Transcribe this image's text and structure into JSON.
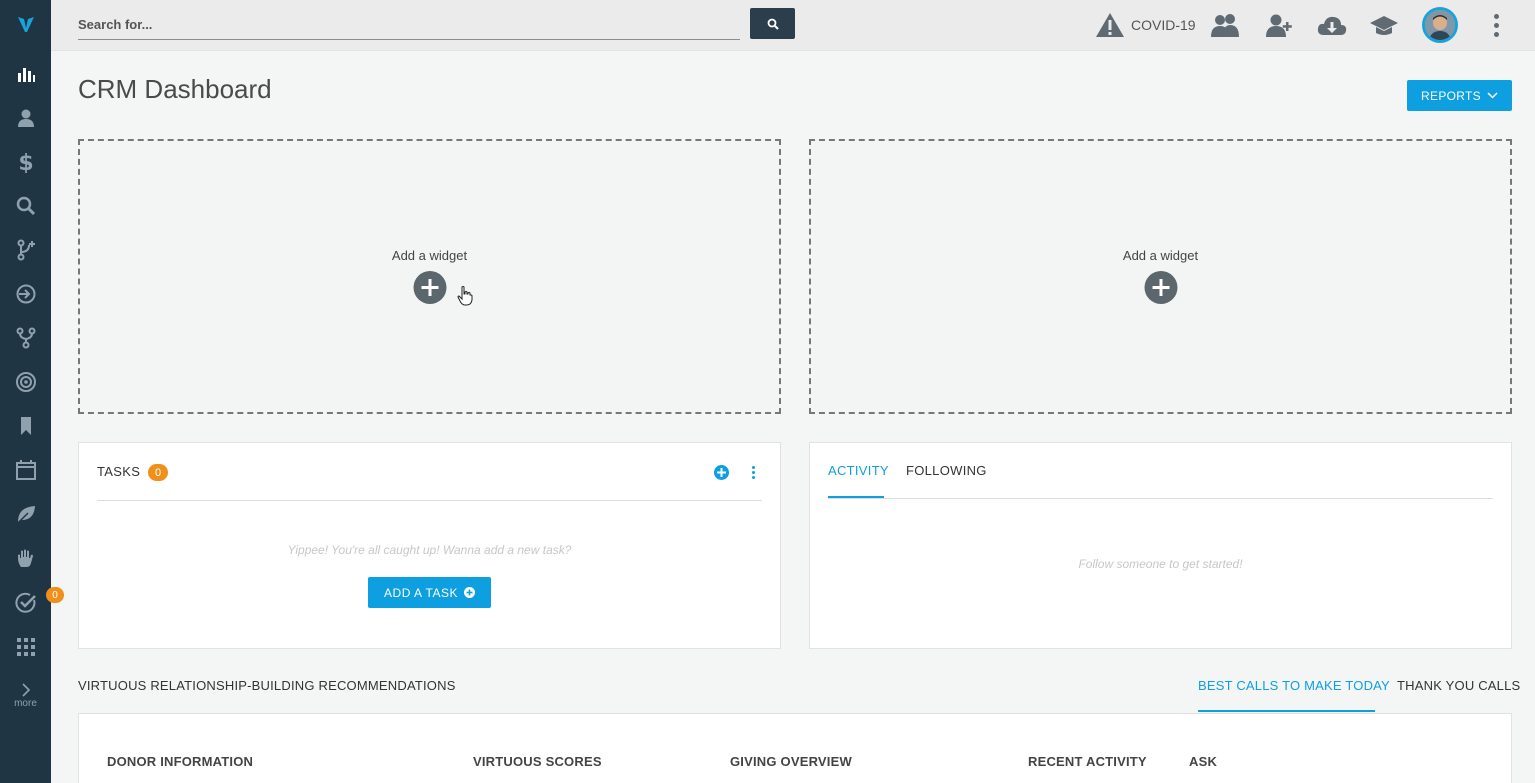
{
  "search": {
    "placeholder": "Search for..."
  },
  "topbar": {
    "covid_label": "COVID-19"
  },
  "page": {
    "title": "CRM Dashboard",
    "reports_label": "REPORTS"
  },
  "widgets": [
    {
      "label": "Add a widget"
    },
    {
      "label": "Add a widget"
    }
  ],
  "tasks": {
    "title": "TASKS",
    "count": "0",
    "empty_text": "Yippee! You're all caught up! Wanna add a new task?",
    "add_label": "ADD A TASK"
  },
  "activity": {
    "tabs": [
      "ACTIVITY",
      "FOLLOWING"
    ],
    "active_tab": "ACTIVITY",
    "empty_text": "Follow someone to get started!"
  },
  "recommendations": {
    "title": "VIRTUOUS RELATIONSHIP-BUILDING RECOMMENDATIONS",
    "tabs": [
      "BEST CALLS TO MAKE TODAY",
      "THANK YOU CALLS"
    ],
    "active_tab": "BEST CALLS TO MAKE TODAY",
    "columns": [
      "DONOR INFORMATION",
      "VIRTUOUS SCORES",
      "GIVING OVERVIEW",
      "RECENT ACTIVITY",
      "ASK"
    ]
  },
  "sidebar": {
    "items": [
      "dashboard-icon",
      "contacts-icon",
      "dollar-icon",
      "search-icon",
      "workflow-icon",
      "import-icon",
      "branch-icon",
      "target-icon",
      "bookmark-icon",
      "calendar-icon",
      "leaf-icon",
      "hand-icon",
      "tasks-check-icon",
      "apps-grid-icon"
    ],
    "tasks_badge": "0",
    "more_label": "more"
  },
  "colors": {
    "accent": "#0d9fe0",
    "sidebar": "#1f3544",
    "badge": "#f0901b"
  }
}
